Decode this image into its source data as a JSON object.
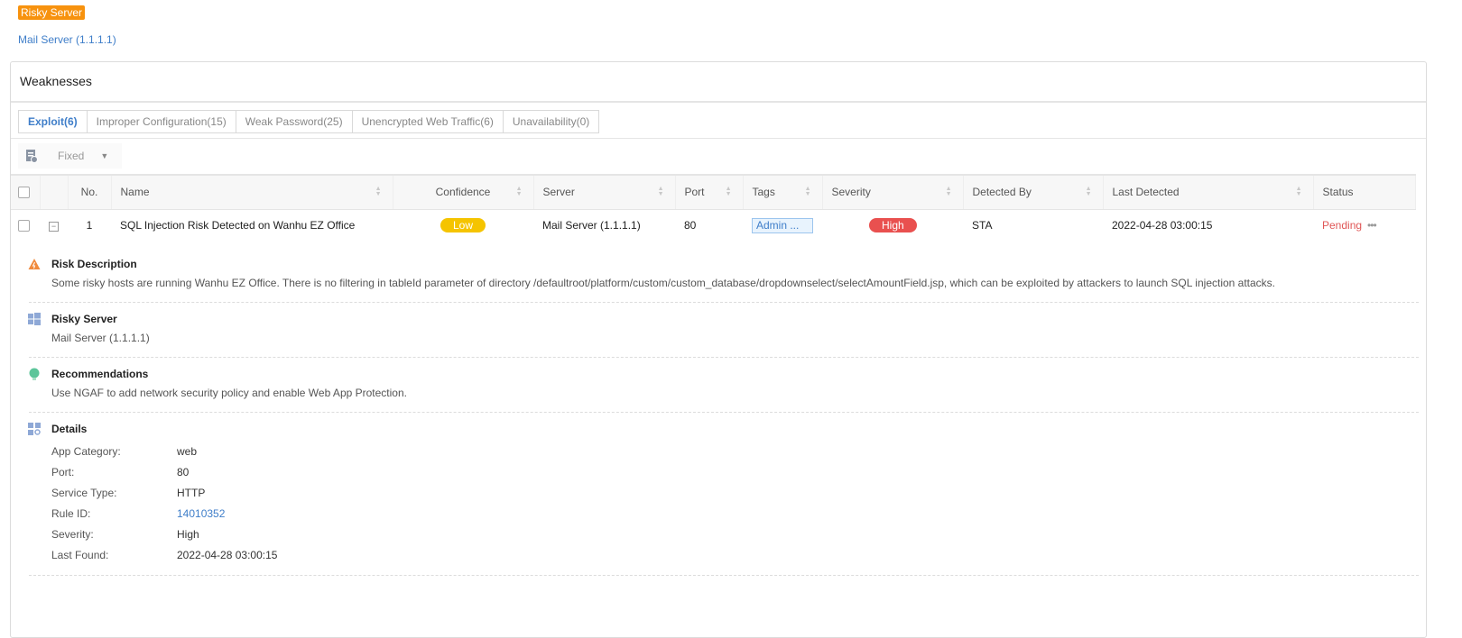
{
  "badge": "Risky Server",
  "server_link": "Mail Server (1.1.1.1)",
  "panel": {
    "title": "Weaknesses"
  },
  "tabs": [
    "Exploit(6)",
    "Improper Configuration(15)",
    "Weak Password(25)",
    "Unencrypted Web Traffic(6)",
    "Unavailability(0)"
  ],
  "toolbar": {
    "filter": "Fixed"
  },
  "columns": [
    "No.",
    "Name",
    "Confidence",
    "Server",
    "Port",
    "Tags",
    "Severity",
    "Detected By",
    "Last Detected",
    "Status"
  ],
  "row": {
    "no": "1",
    "name": "SQL Injection Risk Detected on Wanhu EZ Office",
    "confidence": "Low",
    "server": "Mail Server (1.1.1.1)",
    "port": "80",
    "tags": "Admin ...",
    "severity": "High",
    "detected_by": "STA",
    "last_detected": "2022-04-28 03:00:15",
    "status": "Pending"
  },
  "detail": {
    "risk_title": "Risk Description",
    "risk_text": "Some risky hosts are running Wanhu EZ Office. There is no filtering in tableId parameter of directory /defaultroot/platform/custom/custom_database/dropdownselect/selectAmountField.jsp, which can be exploited by attackers to launch SQL injection attacks.",
    "server_title": "Risky Server",
    "server_text": "Mail Server (1.1.1.1)",
    "rec_title": "Recommendations",
    "rec_text": "Use NGAF to add network security policy and enable Web App Protection.",
    "details_title": "Details",
    "fields": [
      [
        "App Category:",
        "web"
      ],
      [
        "Port:",
        "80"
      ],
      [
        "Service Type:",
        "HTTP"
      ],
      [
        "Rule ID:",
        "14010352"
      ],
      [
        "Severity:",
        "High"
      ],
      [
        "Last Found:",
        "2022-04-28 03:00:15"
      ]
    ]
  },
  "colors": {
    "accent": "#3f7ec9",
    "orange": "#f7920e",
    "low": "#f5c400",
    "high": "#e9504f"
  }
}
